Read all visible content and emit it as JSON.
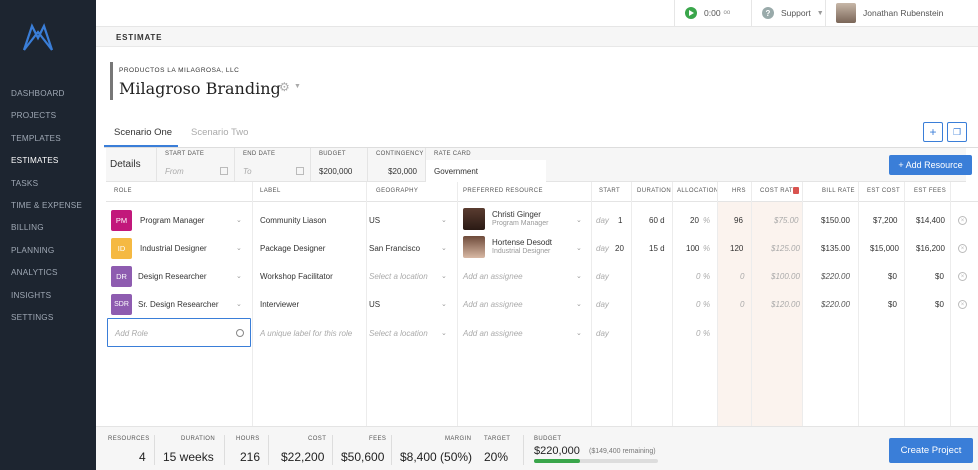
{
  "sidebar": {
    "items": [
      "DASHBOARD",
      "PROJECTS",
      "TEMPLATES",
      "ESTIMATES",
      "TASKS",
      "TIME & EXPENSE",
      "BILLING",
      "PLANNING",
      "ANALYTICS",
      "INSIGHTS",
      "SETTINGS"
    ],
    "active": "ESTIMATES"
  },
  "topbar": {
    "timer": "0:00",
    "timer_unit": "oo",
    "support": "Support",
    "user": "Jonathan Rubenstein"
  },
  "section_title": "ESTIMATE",
  "company": "PRODUCTOS LA MILAGROSA, LLC",
  "project_name": "Milagroso Branding",
  "tabs": [
    "Scenario One",
    "Scenario Two"
  ],
  "details": {
    "label": "Details",
    "start_date_label": "START DATE",
    "start_date_placeholder": "From",
    "end_date_label": "END DATE",
    "end_date_placeholder": "To",
    "budget_label": "BUDGET",
    "budget_value": "$200,000",
    "contingency_label": "CONTINGENCY",
    "contingency_value": "$20,000",
    "rate_card_label": "RATE CARD",
    "rate_card_value": "Government"
  },
  "add_resource_label": "+ Add Resource",
  "columns": [
    "ROLE",
    "LABEL",
    "GEOGRAPHY",
    "PREFERRED RESOURCE",
    "START",
    "DURATION",
    "ALLOCATION",
    "HRS",
    "COST RATE",
    "BILL RATE",
    "EST COST",
    "EST FEES"
  ],
  "rows": [
    {
      "badge": "PM",
      "badge_color": "#c2187b",
      "role": "Program Manager",
      "label": "Community Liason",
      "geography": "US",
      "resource": "Christi Ginger",
      "resource_role": "Program Manager",
      "day_unit": "day",
      "start": "1",
      "duration": "60 d",
      "allocation": "20",
      "alloc_unit": "%",
      "hrs": "96",
      "cost_rate": "$75.00",
      "bill_rate": "$150.00",
      "est_cost": "$7,200",
      "est_fees": "$14,400"
    },
    {
      "badge": "ID",
      "badge_color": "#f5b942",
      "role": "Industrial Designer",
      "label": "Package Designer",
      "geography": "San Francisco",
      "resource": "Hortense Desodt",
      "resource_role": "Industrial Designer",
      "day_unit": "day",
      "start": "20",
      "duration": "15 d",
      "allocation": "100",
      "alloc_unit": "%",
      "hrs": "120",
      "cost_rate": "$125.00",
      "bill_rate": "$135.00",
      "est_cost": "$15,000",
      "est_fees": "$16,200"
    },
    {
      "badge": "DR",
      "badge_color": "#8e5cb0",
      "role": "Design Researcher",
      "label": "Workshop Facilitator",
      "geography": "",
      "geography_placeholder": "Select a location",
      "resource": "",
      "resource_placeholder": "Add an assignee",
      "day_unit": "day",
      "start": "",
      "duration": "",
      "allocation": "0",
      "alloc_unit": "%",
      "hrs": "0",
      "cost_rate": "$100.00",
      "bill_rate": "$220.00",
      "est_cost": "$0",
      "est_fees": "$0"
    },
    {
      "badge": "SDR",
      "badge_color": "#8e5cb0",
      "role": "Sr. Design Researcher",
      "label": "Interviewer",
      "geography": "US",
      "resource": "",
      "resource_placeholder": "Add an assignee",
      "day_unit": "day",
      "start": "",
      "duration": "",
      "allocation": "0",
      "alloc_unit": "%",
      "hrs": "0",
      "cost_rate": "$120.00",
      "bill_rate": "$220.00",
      "est_cost": "$0",
      "est_fees": "$0"
    }
  ],
  "new_row": {
    "role_placeholder": "Add Role",
    "label_placeholder": "A unique label for this role",
    "geography_placeholder": "Select a location",
    "resource_placeholder": "Add an assignee",
    "day_unit": "day",
    "allocation": "0",
    "alloc_unit": "%"
  },
  "footer": {
    "resources_label": "RESOURCES",
    "resources": "4",
    "duration_label": "DURATION",
    "duration": "15 weeks",
    "hours_label": "HOURS",
    "hours": "216",
    "cost_label": "COST",
    "cost": "$22,200",
    "fees_label": "FEES",
    "fees": "$50,600",
    "margin_label": "MARGIN",
    "margin": "$8,400 (50%)",
    "target_label": "TARGET",
    "target": "20%",
    "budget_label": "BUDGET",
    "budget": "$220,000",
    "remaining": "($149,400 remaining)",
    "budget_used_fraction": 0.37
  },
  "create_project_label": "Create Project",
  "colors": {
    "accent": "#3a7ed8",
    "sidebar": "#1d2530",
    "success": "#3aa64b"
  }
}
